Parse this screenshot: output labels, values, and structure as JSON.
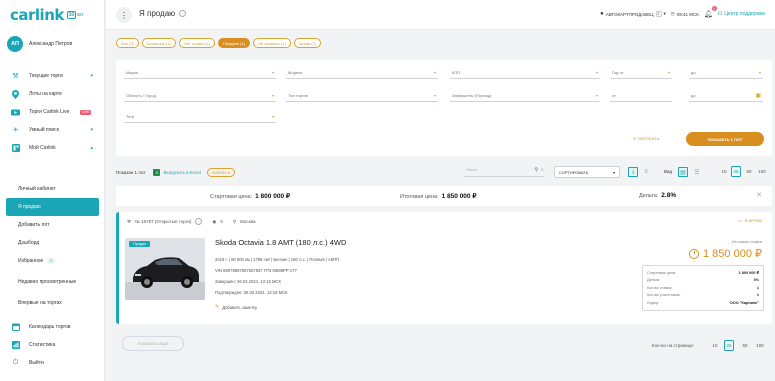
{
  "brand": {
    "word": "carlink",
    "badge": "10",
    "badge_suffix": "ЛЕТ"
  },
  "user": {
    "initials": "АП",
    "name": "Александр Петров"
  },
  "nav": [
    {
      "label": "Текущие торги",
      "icon": "gavel-icon",
      "chevron": true
    },
    {
      "label": "Лоты на карте",
      "icon": "map-pin-icon"
    },
    {
      "label": "Торги Carlink Live",
      "icon": "live-icon",
      "badge": "LIVE"
    },
    {
      "label": "Умный поиск",
      "icon": "bulb-icon",
      "chevron": true
    },
    {
      "label": "Мой Carlink",
      "icon": "dashboard-icon",
      "chevron": true
    }
  ],
  "subnav": [
    {
      "label": "Личный кабинет"
    },
    {
      "label": "Я продаю",
      "active": true
    },
    {
      "label": "Добавить лот"
    },
    {
      "label": "Дэшборд"
    },
    {
      "label": "Избранное",
      "count": "1"
    },
    {
      "label": "Недавно просмотренные"
    },
    {
      "label": "Впервые на торгах"
    }
  ],
  "nav_bottom": [
    {
      "label": "Календарь торгов",
      "icon": "calendar-icon"
    },
    {
      "label": "Статистика",
      "icon": "chart-icon"
    },
    {
      "label": "Выйти",
      "icon": "power-icon"
    }
  ],
  "topbar": {
    "title": "Я продаю",
    "account": "АВТОКАРТПРОДАВЕЦ",
    "account_count": "2",
    "time": "09:41 МСК",
    "notifications": "3",
    "help": "Центр поддержки"
  },
  "tabs": [
    {
      "label": "Все (3)"
    },
    {
      "label": "Активные (1)"
    },
    {
      "label": "Нет ставок (1)"
    },
    {
      "label": "Продано (1)",
      "active": true
    },
    {
      "label": "Не продано (1)"
    },
    {
      "label": "Архив (7)"
    }
  ],
  "filters": {
    "make": "Марка",
    "model": "Модель",
    "gearbox": "КПП",
    "year_from": "Год от",
    "year_to": "до",
    "region": "Область / Город",
    "sale_type": "Тип торгов",
    "completed": "Завершены (Период)",
    "date_from": "от",
    "date_to": "до",
    "tags": "Теги",
    "reset": "СБРОСИТЬ",
    "show": "ПОКАЗАТЬ 1 ЛОТ"
  },
  "toolbar": {
    "found": "Показан 1 лот",
    "excel": "Выгрузить в Excel",
    "files": "ФАЙЛЫ",
    "search_placeholder": "Поиск",
    "sort": "СОРТИРОВАТЬ",
    "view_label": "Вид",
    "page_sizes": [
      "10",
      "25",
      "50",
      "100"
    ],
    "page_size_active": "25"
  },
  "summary": {
    "start_label": "Стартовая цена:",
    "start_value": "1 800 000 ₽",
    "final_label": "Итоговая цена:",
    "final_value": "1 850 000 ₽",
    "share_label": "Дельта:",
    "share_value": "2.8%"
  },
  "lot": {
    "number": "№ 16757 (Открытые торги)",
    "views": "0",
    "city": "Москва",
    "archive": "В АРХИВ",
    "photo_badge": "Продан",
    "title": "Skoda Octavia 1.8 AMT (180 л.с.) 4WD",
    "specs": "2018 г.  |  80 000 км  |  1798 см³  |  Бензин  |  180 л.с.  |  Полный  |  АКПП",
    "vin": "VIN 86978967567567567   ГРЗ М888РР 177",
    "ended": "Завершён: 26.03.2024, 13:15 МСК",
    "confirmed": "Подтвержден: 26.03.2024, 13:18 МСК",
    "note": "Добавить заметку",
    "final_label": "Итоговая ставка",
    "final_price": "1 850 000 ₽",
    "stats": [
      {
        "label": "Стартовая цена:",
        "value": "1 800 000 ₽"
      },
      {
        "label": "Дельта:",
        "value": "3%"
      },
      {
        "label": "Кол-во ставок:",
        "value": "1"
      },
      {
        "label": "Кол-во участников:",
        "value": "1"
      },
      {
        "label": "Лидер:",
        "value": "ООО \"Карлинк\""
      }
    ]
  },
  "bottom": {
    "more": "ПОКАЗАТЬ ЕЩЁ",
    "per_page": "Кол-во на странице:",
    "page_sizes": [
      "10",
      "25",
      "50",
      "100"
    ]
  },
  "colors": {
    "accent": "#1aa6b4",
    "orange": "#d98f1f",
    "sidebar": "#ffffff",
    "bg": "#f1f3f5"
  }
}
